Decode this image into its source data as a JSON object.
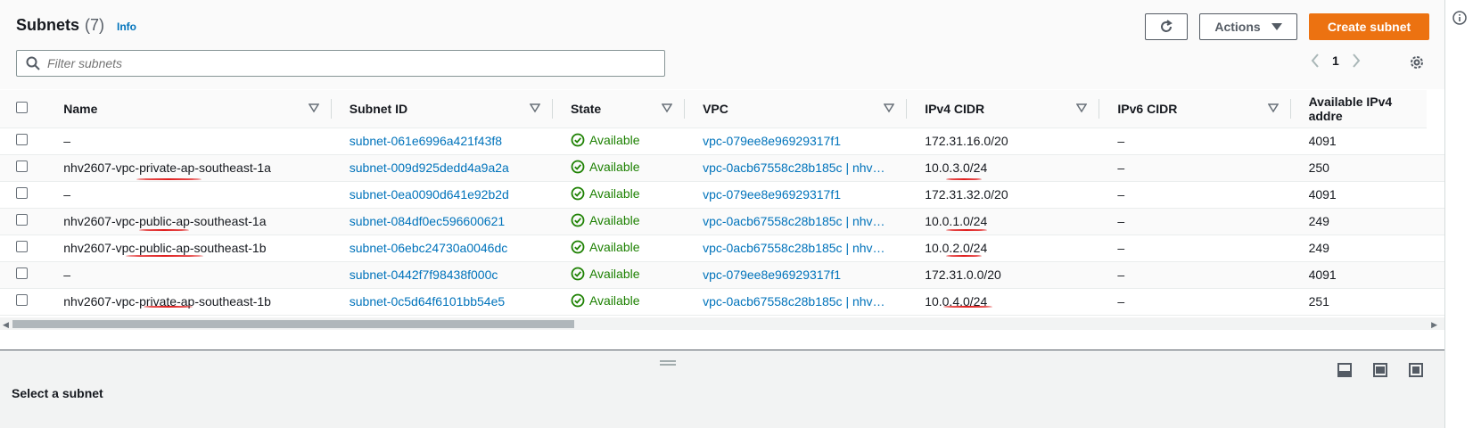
{
  "header": {
    "title": "Subnets",
    "count": "(7)",
    "info": "Info",
    "actions_label": "Actions",
    "create_label": "Create subnet",
    "search_placeholder": "Filter subnets",
    "page_number": "1"
  },
  "table": {
    "columns": [
      "Name",
      "Subnet ID",
      "State",
      "VPC",
      "IPv4 CIDR",
      "IPv6 CIDR",
      "Available IPv4 addre"
    ],
    "rows": [
      {
        "name": "–",
        "subnet_id": "subnet-061e6996a421f43f8",
        "state": "Available",
        "vpc": "vpc-079ee8e96929317f1",
        "ipv4": "172.31.16.0/20",
        "ipv6": "–",
        "available": "4091"
      },
      {
        "name": "nhv2607-vpc-private-ap-southeast-1a",
        "subnet_id": "subnet-009d925dedd4a9a2a",
        "state": "Available",
        "vpc": "vpc-0acb67558c28b185c | nhv…",
        "ipv4": "10.0.3.0/24",
        "ipv6": "–",
        "available": "250"
      },
      {
        "name": "–",
        "subnet_id": "subnet-0ea0090d641e92b2d",
        "state": "Available",
        "vpc": "vpc-079ee8e96929317f1",
        "ipv4": "172.31.32.0/20",
        "ipv6": "–",
        "available": "4091"
      },
      {
        "name": "nhv2607-vpc-public-ap-southeast-1a",
        "subnet_id": "subnet-084df0ec596600621",
        "state": "Available",
        "vpc": "vpc-0acb67558c28b185c | nhv…",
        "ipv4": "10.0.1.0/24",
        "ipv6": "–",
        "available": "249"
      },
      {
        "name": "nhv2607-vpc-public-ap-southeast-1b",
        "subnet_id": "subnet-06ebc24730a0046dc",
        "state": "Available",
        "vpc": "vpc-0acb67558c28b185c | nhv…",
        "ipv4": "10.0.2.0/24",
        "ipv6": "–",
        "available": "249"
      },
      {
        "name": "–",
        "subnet_id": "subnet-0442f7f98438f000c",
        "state": "Available",
        "vpc": "vpc-079ee8e96929317f1",
        "ipv4": "172.31.0.0/20",
        "ipv6": "–",
        "available": "4091"
      },
      {
        "name": "nhv2607-vpc-private-ap-southeast-1b",
        "subnet_id": "subnet-0c5d64f6101bb54e5",
        "state": "Available",
        "vpc": "vpc-0acb67558c28b185c | nhv…",
        "ipv4": "10.0.4.0/24",
        "ipv6": "–",
        "available": "251"
      }
    ]
  },
  "bottom": {
    "message": "Select a subnet"
  },
  "colors": {
    "accent": "#ec7211",
    "link": "#0073bb",
    "success": "#1d8102",
    "annotation": "#e02020"
  }
}
